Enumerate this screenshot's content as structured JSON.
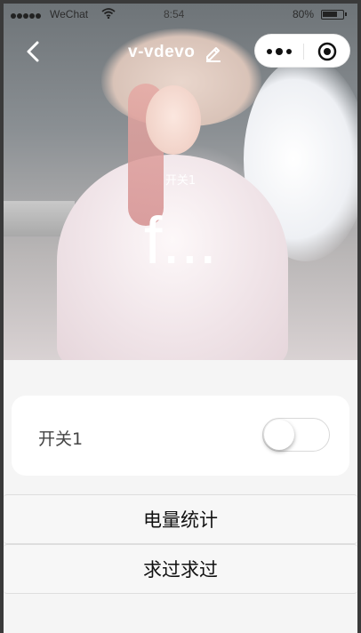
{
  "status_bar": {
    "carrier": "WeChat",
    "time": "8:54",
    "battery": "80%",
    "battery_level": 0.8
  },
  "nav": {
    "title": "v-vdevo"
  },
  "hero": {
    "label": "开关1",
    "value": "f..."
  },
  "switch_card": {
    "label": "开关1",
    "toggle_on": false
  },
  "buttons": [
    {
      "label": "电量统计"
    },
    {
      "label": "求过求过"
    }
  ]
}
